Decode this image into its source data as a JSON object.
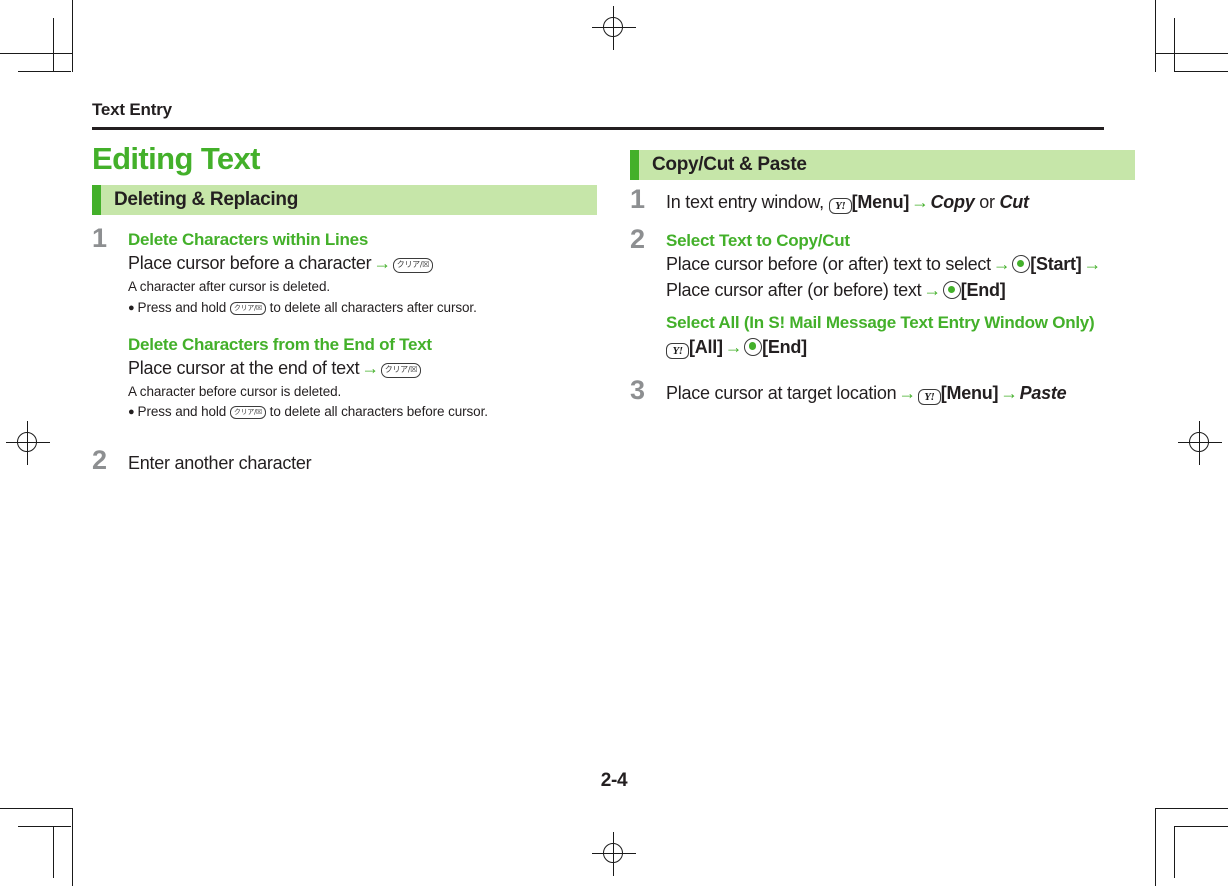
{
  "document": {
    "running_head": "Text Entry",
    "page_number": "2-4"
  },
  "left_column": {
    "chapter_title": "Editing Text",
    "section": {
      "label": "Deleting & Replacing"
    },
    "steps": [
      {
        "number": "1",
        "blocks": [
          {
            "heading": "Delete Characters within Lines",
            "instruction_pre": "Place cursor before a character",
            "key": "clear-key",
            "key_label": "クリア/☒",
            "note": "A character after cursor is deleted.",
            "bullet": "Press and hold",
            "bullet_key_label": "クリア/☒",
            "bullet_tail": "to delete all characters after cursor."
          },
          {
            "heading": "Delete Characters from the End of Text",
            "instruction_pre": "Place cursor at the end of text",
            "key": "clear-key",
            "key_label": "クリア/☒",
            "note": "A character before cursor is deleted.",
            "bullet": "Press and hold",
            "bullet_key_label": "クリア/☒",
            "bullet_tail": "to delete all characters before cursor."
          }
        ]
      },
      {
        "number": "2",
        "instruction": "Enter another character"
      }
    ]
  },
  "right_column": {
    "section": {
      "label": "Copy/Cut & Paste"
    },
    "steps": [
      {
        "number": "1",
        "text_pre": "In text entry window,",
        "yahoo_label": "Y!",
        "menu_label": "[Menu]",
        "option_a": "Copy",
        "or_label": "or",
        "option_b": "Cut"
      },
      {
        "number": "2",
        "heading": "Select Text to Copy/Cut",
        "line1_pre": "Place cursor before (or after) text to select",
        "line1_key_label": "[Start]",
        "line2_pre": "Place cursor after (or before) text",
        "line2_key_label": "[End]",
        "subheading": "Select All (In S! Mail Message Text Entry Window Only)",
        "sub_yahoo_label": "Y!",
        "sub_all_label": "[All]",
        "sub_end_label": "[End]"
      },
      {
        "number": "3",
        "text_pre": "Place cursor at target location",
        "yahoo_label": "Y!",
        "menu_label": "[Menu]",
        "option": "Paste"
      }
    ]
  },
  "symbols": {
    "arrow": "→",
    "bullet": "●"
  },
  "colors": {
    "brand_green": "#43b02a",
    "band_green": "#c6e6a9",
    "step_number_gray": "#8d8f91",
    "text_black": "#231f20"
  }
}
